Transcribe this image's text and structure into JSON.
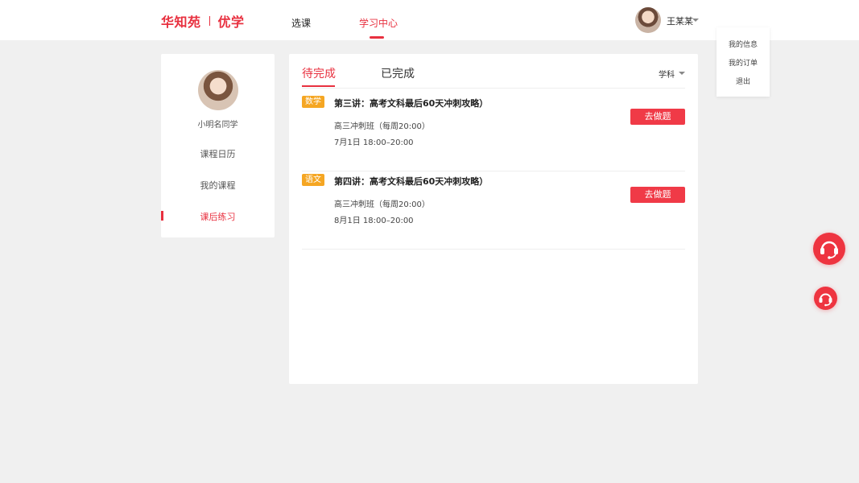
{
  "header": {
    "logo_left": "华知苑",
    "logo_right": "优学",
    "nav": [
      {
        "label": "选课",
        "active": false
      },
      {
        "label": "学习中心",
        "active": true
      }
    ],
    "user_name": "王某某"
  },
  "user_menu": {
    "items": [
      "我的信息",
      "我的订单",
      "退出"
    ]
  },
  "sidebar": {
    "profile_name": "小明名同学",
    "items": [
      {
        "label": "课程日历",
        "active": false
      },
      {
        "label": "我的课程",
        "active": false
      },
      {
        "label": "课后练习",
        "active": true
      }
    ]
  },
  "main": {
    "tabs": [
      {
        "label": "待完成",
        "active": true
      },
      {
        "label": "已完成",
        "active": false
      }
    ],
    "filter_label": "学科",
    "tasks": [
      {
        "subject": "数学",
        "title": "第三讲：高考文科最后60天冲刺攻略）",
        "class_name": "高三冲刺班（每周20:00）",
        "time": "7月1日   18:00–20:00",
        "action_label": "去做题"
      },
      {
        "subject": "语文",
        "title": "第四讲：高考文科最后60天冲刺攻略）",
        "class_name": "高三冲刺班（每周20:00）",
        "time": "8月1日   18:00–20:00",
        "action_label": "去做题"
      }
    ]
  },
  "colors": {
    "accent": "#e8303f",
    "badge": "#f5a623",
    "button": "#f03a47",
    "background": "#f0f0f0"
  },
  "icons": [
    "caret-down-icon",
    "headset-icon"
  ]
}
